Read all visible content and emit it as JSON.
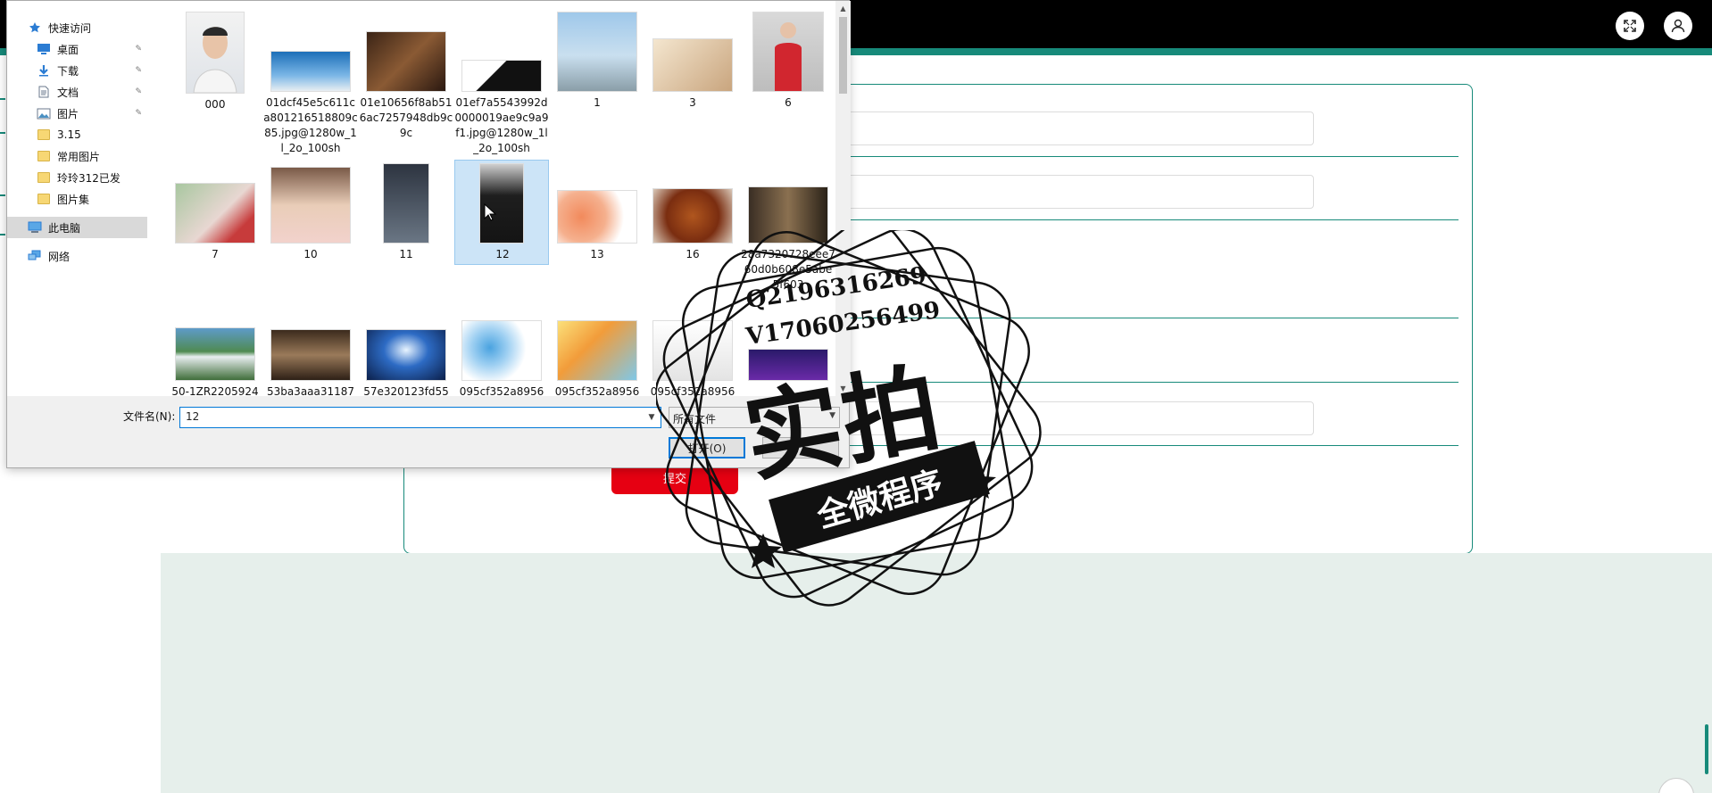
{
  "nav_pane": {
    "items": [
      {
        "label": "快速访问",
        "icon": "star-icon",
        "pinned": false
      },
      {
        "label": "桌面",
        "icon": "desktop-icon",
        "pinned": true
      },
      {
        "label": "下载",
        "icon": "download-icon",
        "pinned": true
      },
      {
        "label": "文档",
        "icon": "document-icon",
        "pinned": true
      },
      {
        "label": "图片",
        "icon": "pictures-icon",
        "pinned": true
      },
      {
        "label": "3.15",
        "icon": "folder-icon",
        "pinned": false
      },
      {
        "label": "常用图片",
        "icon": "folder-icon",
        "pinned": false
      },
      {
        "label": "玲玲312已发",
        "icon": "folder-icon",
        "pinned": false
      },
      {
        "label": "图片集",
        "icon": "folder-icon",
        "pinned": false
      },
      {
        "label": "此电脑",
        "icon": "computer-icon",
        "pinned": false
      },
      {
        "label": "网络",
        "icon": "network-icon",
        "pinned": false
      }
    ]
  },
  "files": [
    {
      "name": "000"
    },
    {
      "name": "01dcf45e5c611ca801216518809c85.jpg@1280w_1l_2o_100sh"
    },
    {
      "name": "01e10656f8ab516ac7257948db9c9c"
    },
    {
      "name": "01ef7a5543992d0000019ae9c9a9f1.jpg@1280w_1l_2o_100sh"
    },
    {
      "name": "1"
    },
    {
      "name": "3"
    },
    {
      "name": "6"
    },
    {
      "name": "7"
    },
    {
      "name": "10"
    },
    {
      "name": "11"
    },
    {
      "name": "12"
    },
    {
      "name": "13"
    },
    {
      "name": "16"
    },
    {
      "name": "28a7320728eee760d0b608e5abe5f603"
    },
    {
      "name": "50-1ZR2205924"
    },
    {
      "name": "53ba3aaa31187"
    },
    {
      "name": "57e320123fd55"
    },
    {
      "name": "095cf352a8956"
    },
    {
      "name": "095cf352a8956"
    },
    {
      "name": "095cf352a8956"
    },
    {
      "name": ""
    }
  ],
  "bottom": {
    "filename_label": "文件名(N):",
    "filename_value": "12",
    "filetype_value": "所有文件",
    "open_label": "打开(O)",
    "cancel_label": ""
  },
  "app": {
    "submit_label": "提交"
  },
  "stamp": {
    "phone1": "Q2196316269",
    "phone2": "V17060256499",
    "main": "实拍",
    "banner": "全微程序"
  },
  "colors": {
    "accent": "#178a7a",
    "submit": "#e60012",
    "selection": "#cce4f7"
  }
}
